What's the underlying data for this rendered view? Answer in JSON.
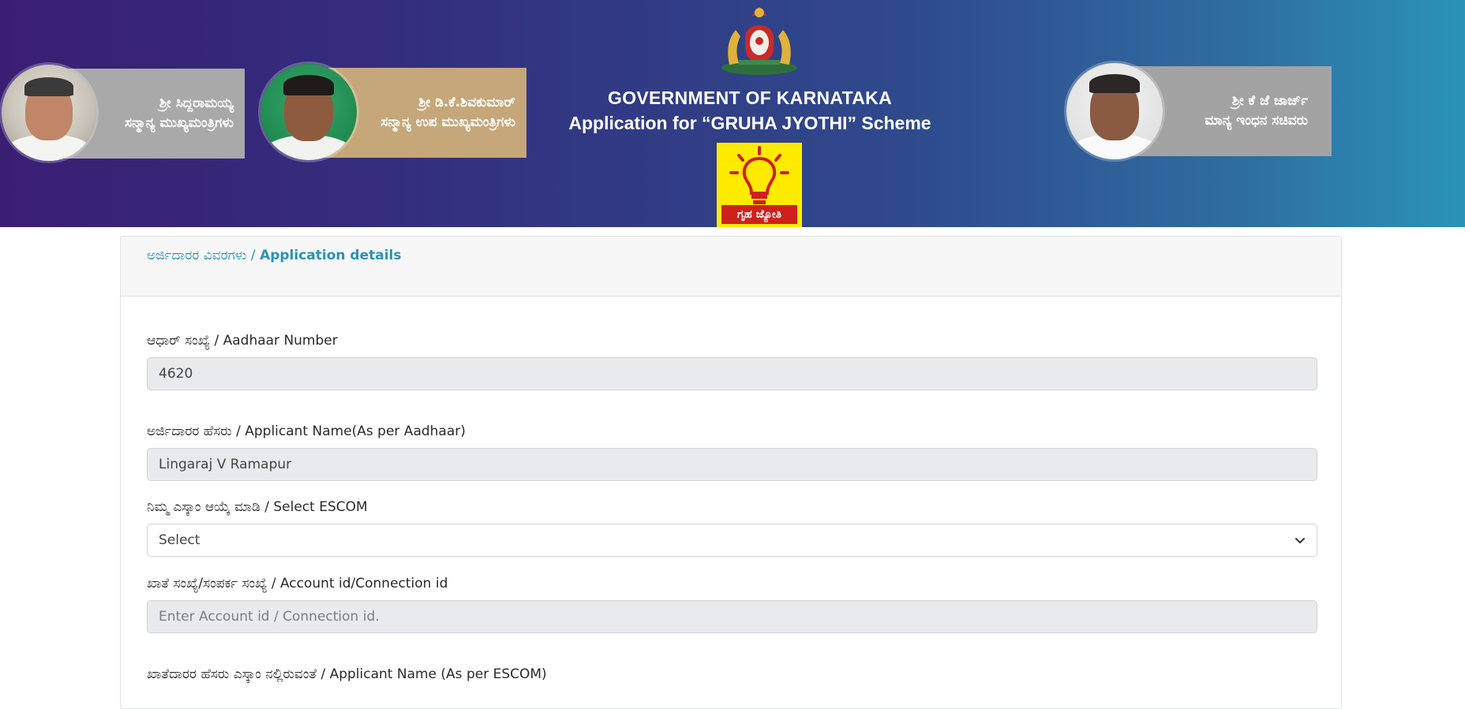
{
  "banner": {
    "leaders": [
      {
        "name_line1": "ಶ್ರೀ ಸಿದ್ದರಾಮಯ್ಯ",
        "name_line2": "ಸನ್ಮಾನ್ಯ ಮುಖ್ಯಮಂತ್ರಿಗಳು",
        "plate_color": "#a9a9a9"
      },
      {
        "name_line1": "ಶ್ರೀ ಡಿ.ಕೆ.ಶಿವಕುಮಾರ್",
        "name_line2": "ಸನ್ಮಾನ್ಯ ಉಪ ಮುಖ್ಯಮಂತ್ರಿಗಳು",
        "plate_color": "#c6a77a"
      },
      {
        "name_line1": "ಶ್ರೀ ಕೆ ಜೆ ಜಾರ್ಜ್",
        "name_line2": "ಮಾನ್ಯ ಇಂಧನ ಸಚಿವರು",
        "plate_color": "#a3a3a3"
      }
    ],
    "title_line1": "GOVERNMENT OF KARNATAKA",
    "title_line2": "Application for “GRUHA JYOTHI” Scheme",
    "logo_caption": "ಗೃಹ ಜ್ಯೋತಿ"
  },
  "card": {
    "header_kn": "ಅರ್ಜಿದಾರರ ವಿವರಗಳು",
    "header_sep": " / ",
    "header_en": "Application details"
  },
  "form": {
    "aadhaar": {
      "label": "ಆಧಾರ್ ಸಂಖ್ಯೆ / Aadhaar Number",
      "value": "4620"
    },
    "applicant_name": {
      "label": "ಅರ್ಜಿದಾರರ ಹೆಸರು / Applicant Name(As per Aadhaar)",
      "value": "Lingaraj V Ramapur"
    },
    "escom": {
      "label": "ನಿಮ್ಮ ಎಸ್ಕಾಂ ಆಯ್ಕೆ ಮಾಡಿ / Select ESCOM",
      "value": "Select"
    },
    "account_id": {
      "label": "ಖಾತೆ ಸಂಖ್ಯೆ/ಸಂಪರ್ಕ ಸಂಖ್ಯೆ / Account id/Connection id",
      "placeholder": "Enter Account id / Connection id."
    },
    "escom_name": {
      "label": "ಖಾತೆದಾರರ ಹೆಸರು ಎಸ್ಕಾಂ ನಲ್ಲಿರುವಂತೆ / Applicant Name (As per ESCOM)"
    }
  },
  "colors": {
    "accent": "#2b93b4",
    "readonly_bg": "#e8ebee",
    "banner_start": "#3a1e73",
    "banner_end": "#2a93b8"
  }
}
